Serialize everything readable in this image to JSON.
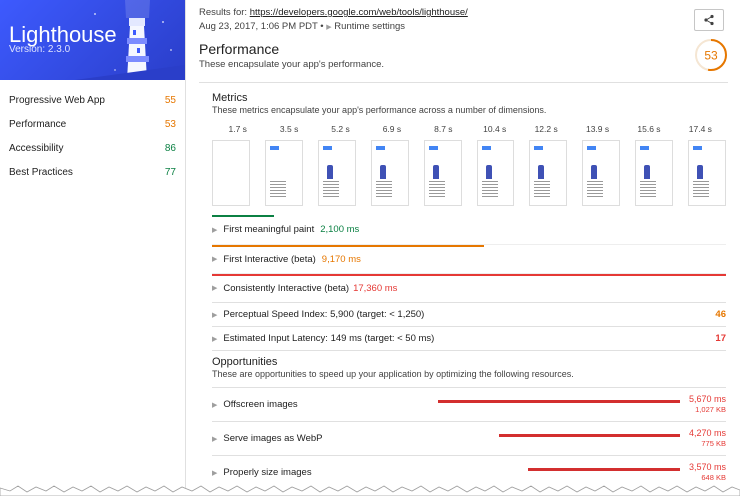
{
  "sidebar": {
    "title": "Lighthouse",
    "version": "Version: 2.3.0",
    "categories": [
      {
        "label": "Progressive Web App",
        "score": "55",
        "color": "#e67700"
      },
      {
        "label": "Performance",
        "score": "53",
        "color": "#e67700"
      },
      {
        "label": "Accessibility",
        "score": "86",
        "color": "#0b8043"
      },
      {
        "label": "Best Practices",
        "score": "77",
        "color": "#0b8043"
      }
    ]
  },
  "topbar": {
    "results_prefix": "Results for: ",
    "url": "https://developers.google.com/web/tools/lighthouse/",
    "date": "Aug 23, 2017, 1:06 PM PDT",
    "runtime": "Runtime settings"
  },
  "performance": {
    "title": "Performance",
    "description": "These encapsulate your app's performance.",
    "score": "53",
    "score_color": "#e67700"
  },
  "metrics": {
    "title": "Metrics",
    "description": "These metrics encapsulate your app's performance across a number of dimensions.",
    "film_times": [
      "1.7 s",
      "3.5 s",
      "5.2 s",
      "6.9 s",
      "8.7 s",
      "10.4 s",
      "12.2 s",
      "13.9 s",
      "15.6 s",
      "17.4 s"
    ],
    "timeline": [
      {
        "label": "First meaningful paint",
        "value": "2,100 ms",
        "status": "good",
        "color": "#0b8043",
        "fraction": 0.12
      },
      {
        "label": "First Interactive (beta)",
        "value": "9,170 ms",
        "status": "warn",
        "color": "#e67700",
        "fraction": 0.53
      },
      {
        "label": "Consistently Interactive (beta)",
        "value": "17,360 ms",
        "status": "bad",
        "color": "#e53935",
        "fraction": 1.0
      }
    ],
    "audits": [
      {
        "label": "Perceptual Speed Index: 5,900 (target: < 1,250)",
        "score": "46",
        "color": "#e67700"
      },
      {
        "label": "Estimated Input Latency: 149 ms (target: < 50 ms)",
        "score": "17",
        "color": "#e53935"
      }
    ]
  },
  "opportunities": {
    "title": "Opportunities",
    "description": "These are opportunities to speed up your application by optimizing the following resources.",
    "items": [
      {
        "label": "Offscreen images",
        "ms": "5,670 ms",
        "kb": "1,027 KB",
        "fraction": 1.0
      },
      {
        "label": "Serve images as WebP",
        "ms": "4,270 ms",
        "kb": "775 KB",
        "fraction": 0.75
      },
      {
        "label": "Properly size images",
        "ms": "3,570 ms",
        "kb": "648 KB",
        "fraction": 0.63
      }
    ]
  }
}
